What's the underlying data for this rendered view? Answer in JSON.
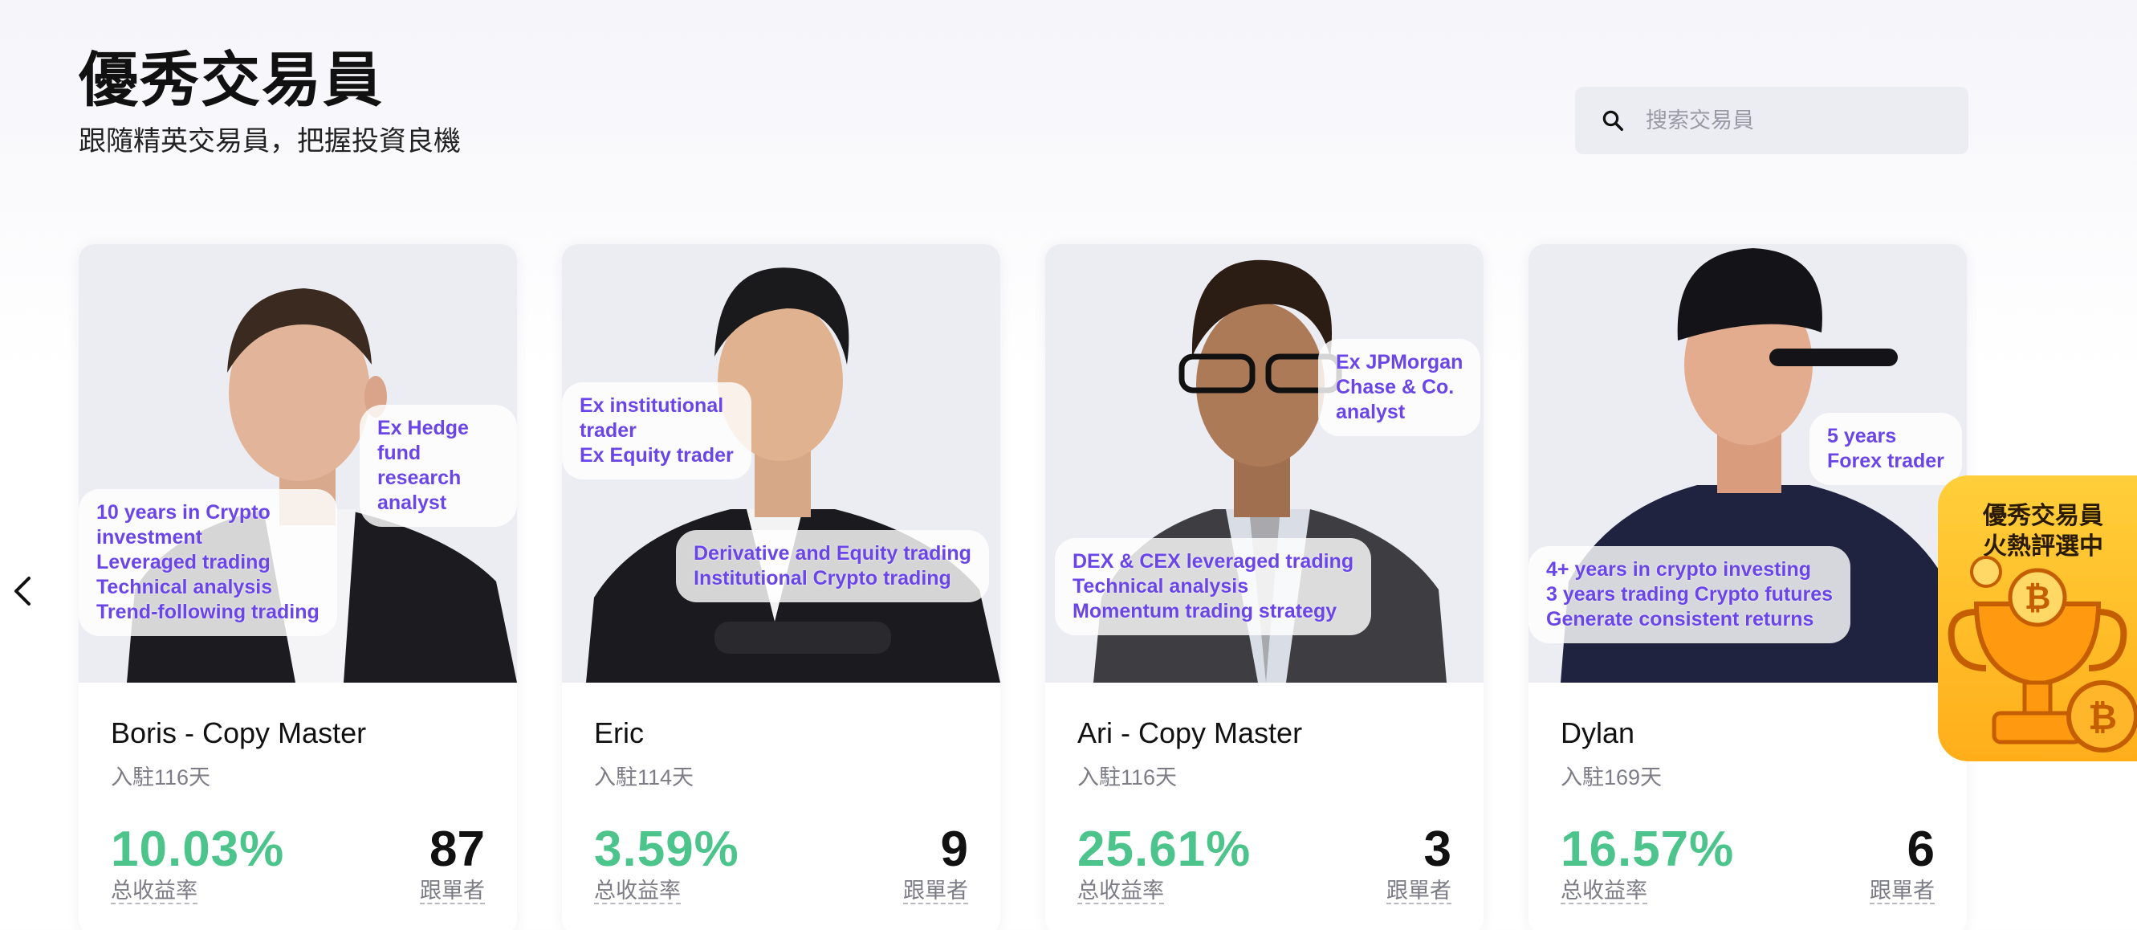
{
  "header": {
    "title": "優秀交易員",
    "subtitle": "跟隨精英交易員，把握投資良機"
  },
  "search": {
    "placeholder": "搜索交易員"
  },
  "traders": [
    {
      "name": "Boris - Copy Master",
      "joined": "入駐116天",
      "roi": "10.03%",
      "roi_label": "总收益率",
      "followers": "87",
      "followers_label": "跟單者",
      "tag_top": "Ex Hedge\nfund research\nanalyst",
      "tag_bottom": "10 years in Crypto\ninvestment\nLeveraged trading\nTechnical analysis\nTrend-following trading"
    },
    {
      "name": "Eric",
      "joined": "入駐114天",
      "roi": "3.59%",
      "roi_label": "总收益率",
      "followers": "9",
      "followers_label": "跟單者",
      "tag_top": "Ex institutional\ntrader\nEx Equity trader",
      "tag_bottom": "Derivative and Equity trading\nInstitutional Crypto trading"
    },
    {
      "name": "Ari - Copy Master",
      "joined": "入駐116天",
      "roi": "25.61%",
      "roi_label": "总收益率",
      "followers": "3",
      "followers_label": "跟單者",
      "tag_top": "Ex JPMorgan\nChase & Co.\nanalyst",
      "tag_bottom": "DEX & CEX leveraged trading\nTechnical analysis\nMomentum trading strategy"
    },
    {
      "name": "Dylan",
      "joined": "入駐169天",
      "roi": "16.57%",
      "roi_label": "总收益率",
      "followers": "6",
      "followers_label": "跟單者",
      "tag_top": "5 years\nForex trader",
      "tag_bottom": "4+ years in crypto investing\n3 years trading Crypto futures\nGenerate consistent returns"
    }
  ],
  "promo": {
    "text": "優秀交易員\n火熱評選中"
  },
  "colors": {
    "roi_green": "#4cc48c",
    "tag_purple": "#6a45e8",
    "promo_gold": "#ffc229"
  }
}
